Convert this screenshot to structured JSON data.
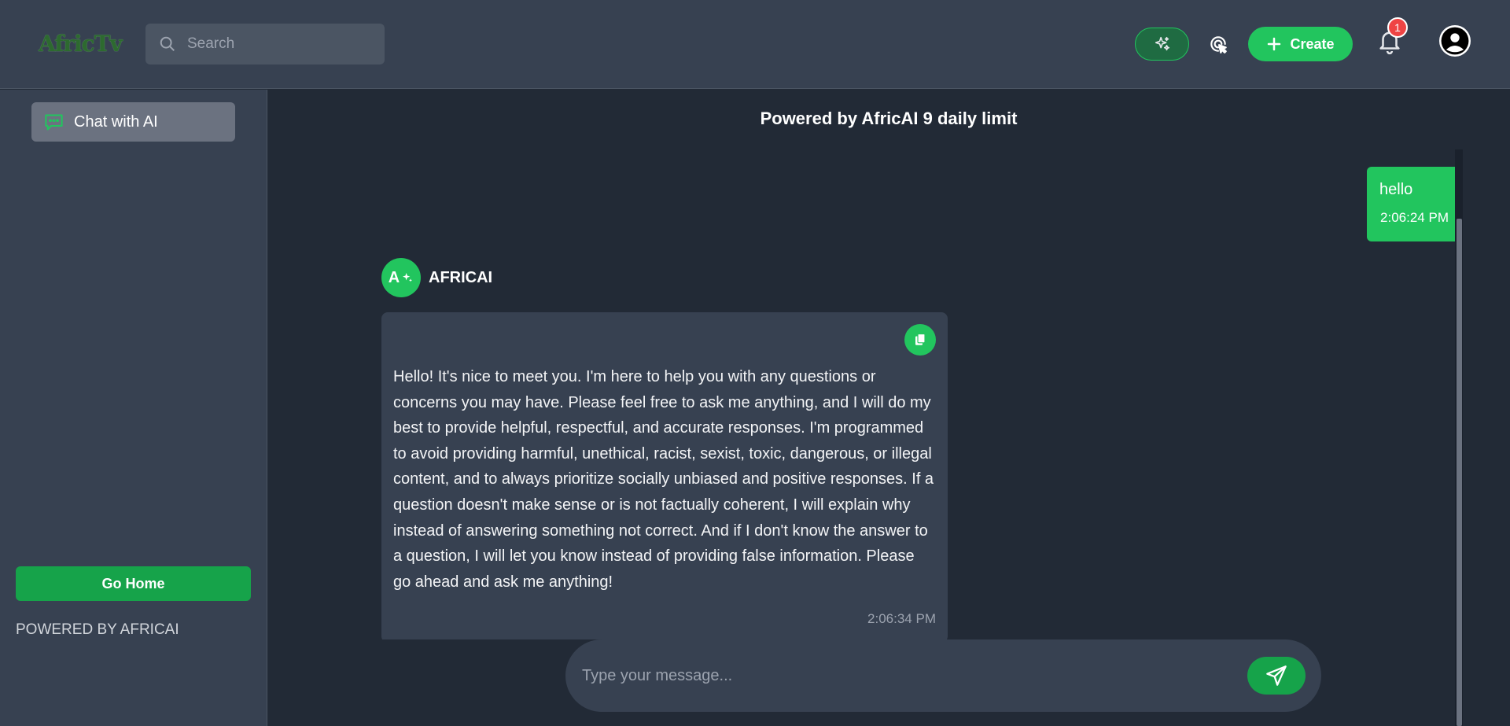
{
  "header": {
    "logo_text": "AfricTv",
    "search": {
      "placeholder": "Search",
      "value": ""
    },
    "create_label": "Create",
    "notifications_count": "1"
  },
  "sidebar": {
    "items": [
      {
        "label": "Chat with AI",
        "icon": "chat-bubble-icon"
      }
    ],
    "go_home_label": "Go Home",
    "powered_text": "POWERED BY AFRICAI"
  },
  "main": {
    "title": "Powered by AfricAI 9 daily limit",
    "messages": [
      {
        "role": "user",
        "text": "hello",
        "time": "2:06:24 PM"
      },
      {
        "role": "assistant",
        "sender": "AFRICAI",
        "avatar_letter": "A",
        "text": "Hello! It's nice to meet you. I'm here to help you with any questions or concerns you may have. Please feel free to ask me anything, and I will do my best to provide helpful, respectful, and accurate responses. I'm programmed to avoid providing harmful, unethical, racist, sexist, toxic, dangerous, or illegal content, and to always prioritize socially unbiased and positive responses. If a question doesn't make sense or is not factually coherent, I will explain why instead of answering something not correct. And if I don't know the answer to a question, I will let you know instead of providing false information. Please go ahead and ask me anything!",
        "time": "2:06:34 PM"
      }
    ],
    "composer": {
      "placeholder": "Type your message...",
      "value": ""
    }
  },
  "colors": {
    "accent": "#22c55e",
    "topbar": "#374151",
    "background": "#222a36",
    "badge": "#ef4444"
  }
}
